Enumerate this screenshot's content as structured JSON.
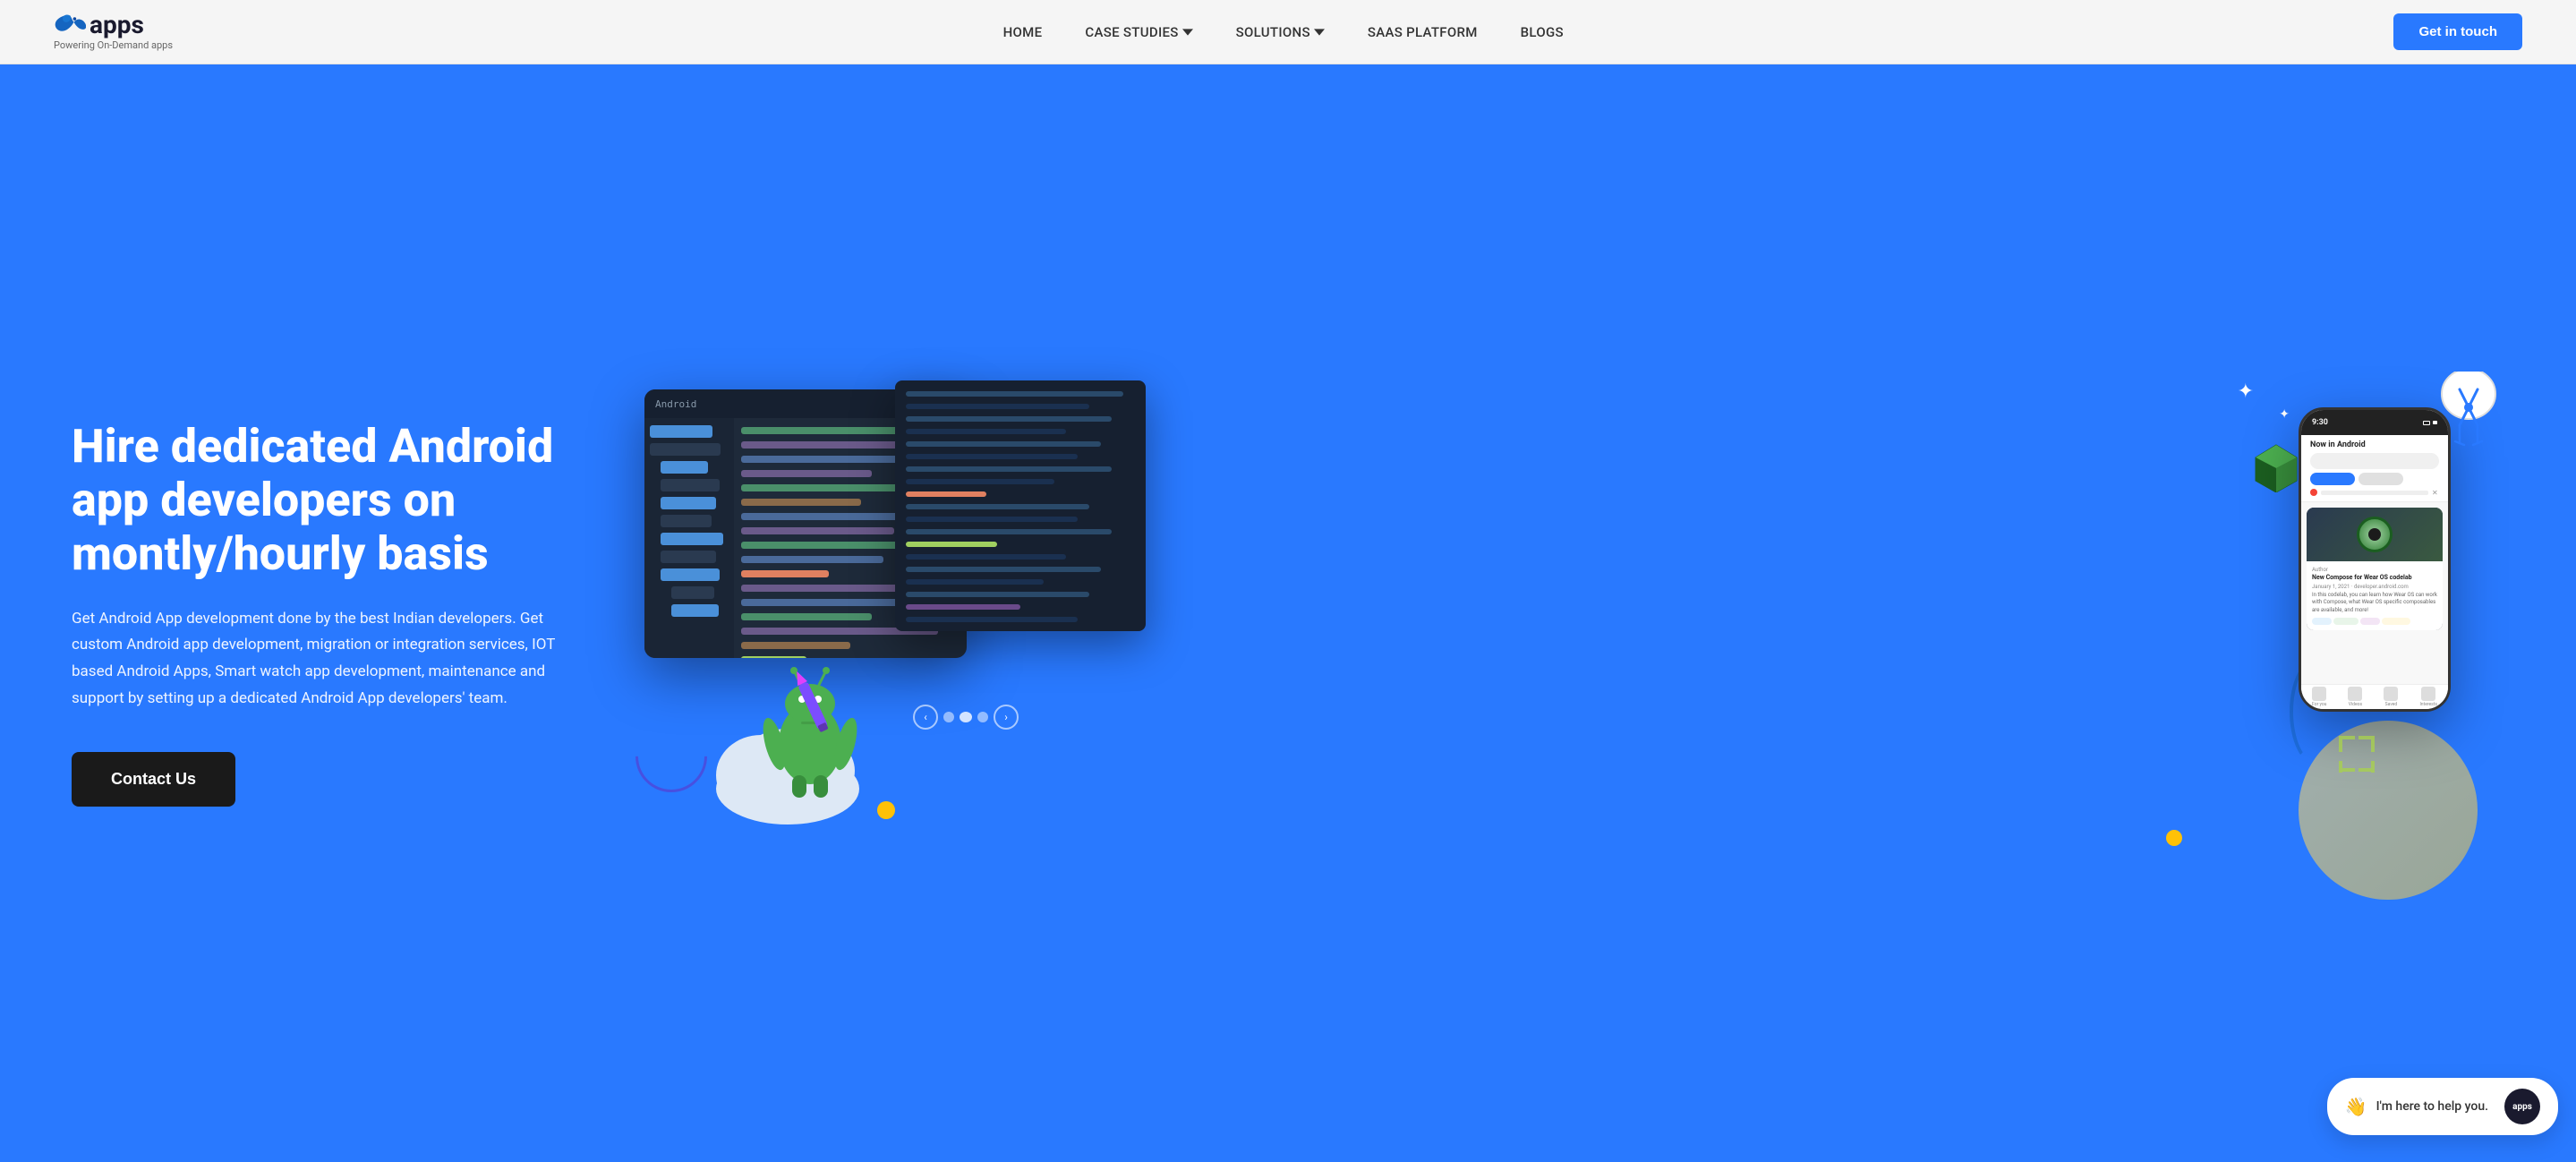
{
  "brand": {
    "name": "apps",
    "tagline": "Powering On-Demand apps"
  },
  "nav": {
    "links": [
      {
        "label": "HOME",
        "href": "#",
        "has_dropdown": false
      },
      {
        "label": "CASE STUDIES",
        "href": "#",
        "has_dropdown": true
      },
      {
        "label": "SOLUTIONS",
        "href": "#",
        "has_dropdown": true
      },
      {
        "label": "SAAS PLATFORM",
        "href": "#",
        "has_dropdown": false
      },
      {
        "label": "BLOGS",
        "href": "#",
        "has_dropdown": false
      }
    ],
    "cta_label": "Get in touch"
  },
  "hero": {
    "title": "Hire dedicated Android app developers on montly/hourly basis",
    "description": "Get Android App development done by the best Indian developers. Get custom Android app development, migration or integration services, IOT based Android Apps, Smart watch app development, maintenance and support by setting up a dedicated Android App developers' team.",
    "cta_label": "Contact Us"
  },
  "chat": {
    "message": "I'm here to help you.",
    "emoji": "👋",
    "avatar_text": "apps"
  },
  "colors": {
    "hero_bg": "#2979ff",
    "nav_bg": "#f5f5f5",
    "btn_dark": "#1a1a1a",
    "btn_blue": "#2979ff",
    "ide_bg": "#1e2a3a",
    "accent_green": "#4caf50",
    "accent_pink": "#e91e63",
    "accent_yellow": "#ffc107"
  }
}
